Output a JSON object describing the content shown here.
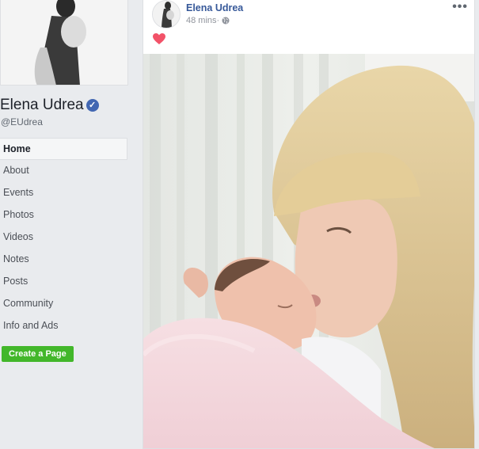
{
  "profile": {
    "name": "Elena Udrea",
    "handle": "@EUdrea"
  },
  "nav": {
    "items": [
      {
        "label": "Home"
      },
      {
        "label": "About"
      },
      {
        "label": "Events"
      },
      {
        "label": "Photos"
      },
      {
        "label": "Videos"
      },
      {
        "label": "Notes"
      },
      {
        "label": "Posts"
      },
      {
        "label": "Community"
      },
      {
        "label": "Info and Ads"
      }
    ],
    "active_index": 0
  },
  "create_page_label": "Create a Page",
  "post": {
    "author": "Elena Udrea",
    "time": "48 mins",
    "separator": " · ",
    "more": "•••",
    "reaction": "heart-icon",
    "photo_description": "heart-icon"
  },
  "colors": {
    "link": "#365899",
    "verified": "#4267b2",
    "create_button": "#42b72a",
    "heart": "#f25268"
  },
  "icons": {
    "verified": "checkmark-badge-icon",
    "privacy": "globe-icon",
    "menu": "more-options-icon"
  }
}
